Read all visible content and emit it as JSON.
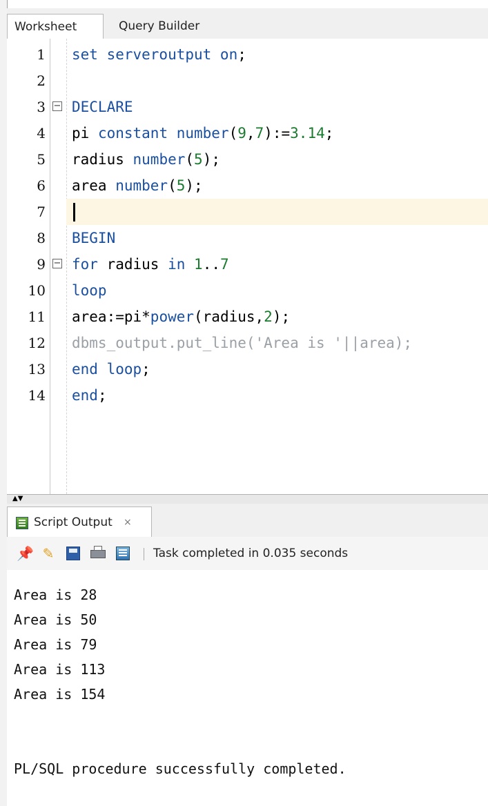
{
  "tabs": [
    {
      "label": "Worksheet"
    },
    {
      "label": "Query Builder"
    }
  ],
  "editor": {
    "lines": [
      {
        "number": "1",
        "tokens": [
          {
            "t": "set serveroutput on",
            "c": "kw"
          },
          {
            "t": ";",
            "c": ""
          }
        ]
      },
      {
        "number": "2",
        "tokens": []
      },
      {
        "number": "3",
        "fold": "⊟",
        "tokens": [
          {
            "t": "DECLARE",
            "c": "kw"
          }
        ]
      },
      {
        "number": "4",
        "tokens": [
          {
            "t": "pi ",
            "c": ""
          },
          {
            "t": "constant number",
            "c": "kw"
          },
          {
            "t": "(",
            "c": ""
          },
          {
            "t": "9",
            "c": "num"
          },
          {
            "t": ",",
            "c": ""
          },
          {
            "t": "7",
            "c": "num"
          },
          {
            "t": "):=",
            "c": ""
          },
          {
            "t": "3.14",
            "c": "num"
          },
          {
            "t": ";",
            "c": ""
          }
        ]
      },
      {
        "number": "5",
        "tokens": [
          {
            "t": "radius ",
            "c": ""
          },
          {
            "t": "number",
            "c": "kw"
          },
          {
            "t": "(",
            "c": ""
          },
          {
            "t": "5",
            "c": "num"
          },
          {
            "t": ");",
            "c": ""
          }
        ]
      },
      {
        "number": "6",
        "tokens": [
          {
            "t": "area ",
            "c": ""
          },
          {
            "t": "number",
            "c": "kw"
          },
          {
            "t": "(",
            "c": ""
          },
          {
            "t": "5",
            "c": "num"
          },
          {
            "t": ");",
            "c": ""
          }
        ]
      },
      {
        "number": "7",
        "tokens": [],
        "current": true
      },
      {
        "number": "8",
        "tokens": [
          {
            "t": "BEGIN",
            "c": "kw"
          }
        ]
      },
      {
        "number": "9",
        "fold": "⊟",
        "tokens": [
          {
            "t": "for",
            "c": "kw"
          },
          {
            "t": " radius ",
            "c": ""
          },
          {
            "t": "in",
            "c": "kw"
          },
          {
            "t": " ",
            "c": ""
          },
          {
            "t": "1",
            "c": "num"
          },
          {
            "t": "..",
            "c": ""
          },
          {
            "t": "7",
            "c": "num"
          }
        ]
      },
      {
        "number": "10",
        "tokens": [
          {
            "t": "loop",
            "c": "kw"
          }
        ]
      },
      {
        "number": "11",
        "tokens": [
          {
            "t": "area:=pi*",
            "c": ""
          },
          {
            "t": "power",
            "c": "kw"
          },
          {
            "t": "(radius,",
            "c": ""
          },
          {
            "t": "2",
            "c": "num"
          },
          {
            "t": ");",
            "c": ""
          }
        ]
      },
      {
        "number": "12",
        "tokens": [
          {
            "t": "dbms_output.put_line('Area is '||area);",
            "c": "cmt"
          }
        ]
      },
      {
        "number": "13",
        "tokens": [
          {
            "t": "end loop",
            "c": "kw"
          },
          {
            "t": ";",
            "c": ""
          }
        ]
      },
      {
        "number": "14",
        "tokens": [
          {
            "t": "end",
            "c": "kw"
          },
          {
            "t": ";",
            "c": ""
          }
        ]
      }
    ]
  },
  "output_panel": {
    "tab_label": "Script Output",
    "close_glyph": "×",
    "status": "Task completed in 0.035 seconds",
    "lines": [
      "Area is 28",
      "Area is 50",
      "Area is 79",
      "Area is 113",
      "Area is 154",
      "",
      "",
      "PL/SQL procedure successfully completed."
    ]
  },
  "icons": [
    "pin-icon",
    "eraser-icon",
    "save-icon",
    "print-icon",
    "script-icon"
  ]
}
